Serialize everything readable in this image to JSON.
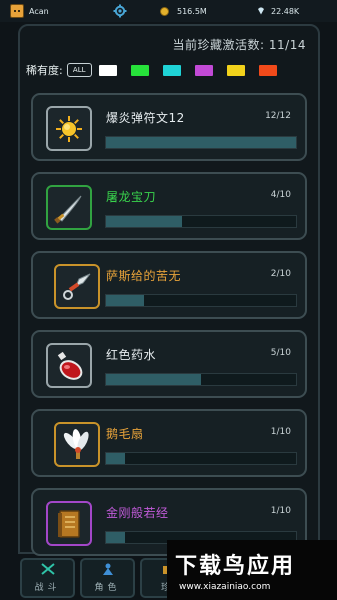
{
  "topbar": {
    "player_name": "Acan",
    "gold": "516.5M",
    "gems": "22.48K"
  },
  "panel": {
    "activated_count": "当前珍藏激活数: 11/14",
    "filter_label": "稀有度:",
    "filter_all": "ALL",
    "filter_colors": [
      "#ffffff",
      "#27e23a",
      "#1fd3d6",
      "#c24ad6",
      "#f2d21b",
      "#f24a1a"
    ]
  },
  "treasures": [
    {
      "name": "爆炎弹符文12",
      "progress": "12/12",
      "fill": 1.0,
      "color": "#e6ecef",
      "rarity": "white",
      "icon": "sun-rune-icon"
    },
    {
      "name": "屠龙宝刀",
      "progress": "4/10",
      "fill": 0.4,
      "color": "#39d34c",
      "rarity": "green",
      "icon": "saber-icon"
    },
    {
      "name": "萨斯给的苦无",
      "progress": "2/10",
      "fill": 0.2,
      "color": "#e8a33a",
      "rarity": "gold",
      "icon": "kunai-icon"
    },
    {
      "name": "红色药水",
      "progress": "5/10",
      "fill": 0.5,
      "color": "#e6ecef",
      "rarity": "white",
      "icon": "red-potion-icon"
    },
    {
      "name": "鹅毛扇",
      "progress": "1/10",
      "fill": 0.1,
      "color": "#e8a33a",
      "rarity": "gold",
      "icon": "feather-fan-icon"
    },
    {
      "name": "金刚般若经",
      "progress": "1/10",
      "fill": 0.1,
      "color": "#c15bd9",
      "rarity": "purple",
      "icon": "scripture-book-icon"
    }
  ],
  "nav": [
    {
      "label": "战斗",
      "icon": "crossed-swords-icon"
    },
    {
      "label": "角色",
      "icon": "character-icon"
    },
    {
      "label": "珍",
      "icon": "treasure-icon"
    }
  ],
  "watermark": {
    "main": "下载鸟应用",
    "sub": "www.xiazainiao.com"
  }
}
